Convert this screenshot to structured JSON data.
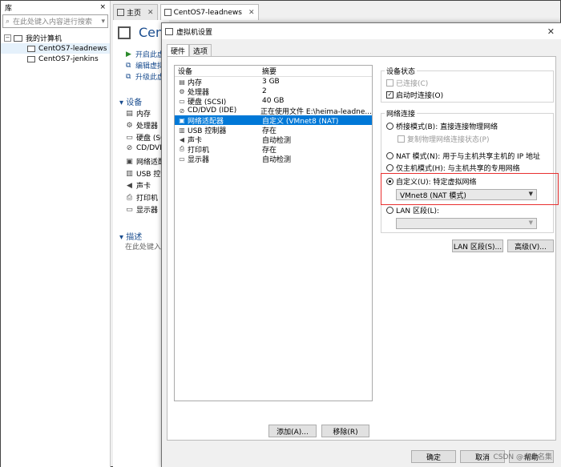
{
  "library": {
    "title": "库",
    "close": "×",
    "search_placeholder": "在此处键入内容进行搜索",
    "tree": [
      {
        "label": "我的计算机",
        "level": 0
      },
      {
        "label": "CentOS7-leadnews",
        "level": 1,
        "selected": true
      },
      {
        "label": "CentOS7-jenkins",
        "level": 1,
        "selected": false
      }
    ]
  },
  "tabs": [
    {
      "label": "主页",
      "active": false
    },
    {
      "label": "CentOS7-leadnews",
      "active": true
    }
  ],
  "vm_page": {
    "title": "Cent",
    "actions": [
      "开启此虚",
      "编辑虚拟",
      "升级此虚"
    ],
    "devices_header": "设备",
    "devices": [
      {
        "icon": "memory-icon",
        "label": "内存"
      },
      {
        "icon": "cpu-icon",
        "label": "处理器"
      },
      {
        "icon": "disk-icon",
        "label": "硬盘 (SC"
      },
      {
        "icon": "cd-icon",
        "label": "CD/DVD"
      },
      {
        "icon": "network-icon",
        "label": "网络适配"
      },
      {
        "icon": "usb-icon",
        "label": "USB 控制"
      },
      {
        "icon": "sound-icon",
        "label": "声卡"
      },
      {
        "icon": "printer-icon",
        "label": "打印机"
      },
      {
        "icon": "display-icon",
        "label": "显示器"
      }
    ],
    "desc_header": "描述",
    "desc_hint": "在此处键入"
  },
  "dialog": {
    "title": "虚拟机设置",
    "close": "✕",
    "tabs": [
      "硬件",
      "选项"
    ],
    "list_headers": {
      "device": "设备",
      "summary": "摘要"
    },
    "devices": [
      {
        "icon": "memory-icon",
        "name": "内存",
        "summary": "3 GB"
      },
      {
        "icon": "cpu-icon",
        "name": "处理器",
        "summary": "2"
      },
      {
        "icon": "disk-icon",
        "name": "硬盘 (SCSI)",
        "summary": "40 GB"
      },
      {
        "icon": "cd-icon",
        "name": "CD/DVD (IDE)",
        "summary": "正在使用文件 E:\\heima-leadne..."
      },
      {
        "icon": "network-icon",
        "name": "网络适配器",
        "summary": "自定义 (VMnet8 (NAT)",
        "selected": true
      },
      {
        "icon": "usb-icon",
        "name": "USB 控制器",
        "summary": "存在"
      },
      {
        "icon": "sound-icon",
        "name": "声卡",
        "summary": "自动检测"
      },
      {
        "icon": "printer-icon",
        "name": "打印机",
        "summary": "存在"
      },
      {
        "icon": "display-icon",
        "name": "显示器",
        "summary": "自动检测"
      }
    ],
    "add_button": "添加(A)...",
    "remove_button": "移除(R)",
    "device_status": {
      "label": "设备状态",
      "connected": "已连接(C)",
      "connect_on_start": "启动时连接(O)"
    },
    "network": {
      "label": "网络连接",
      "bridged": "桥接模式(B): 直接连接物理网络",
      "replicate": "复制物理网络连接状态(P)",
      "nat": "NAT 模式(N): 用于与主机共享主机的 IP 地址",
      "host_only": "仅主机模式(H): 与主机共享的专用网络",
      "custom": "自定义(U): 特定虚拟网络",
      "custom_value": "VMnet8 (NAT 模式)",
      "lan": "LAN 区段(L):",
      "lan_value": "",
      "lan_button": "LAN 区段(S)...",
      "advanced_button": "高级(V)..."
    },
    "ok_button": "确定",
    "cancel_button": "取消",
    "help_button": "帮助"
  },
  "watermark": "CSDN @未命名集",
  "colors": {
    "selection": "#0078d7",
    "highlight": "#e83030",
    "link": "#1a4d8f"
  }
}
